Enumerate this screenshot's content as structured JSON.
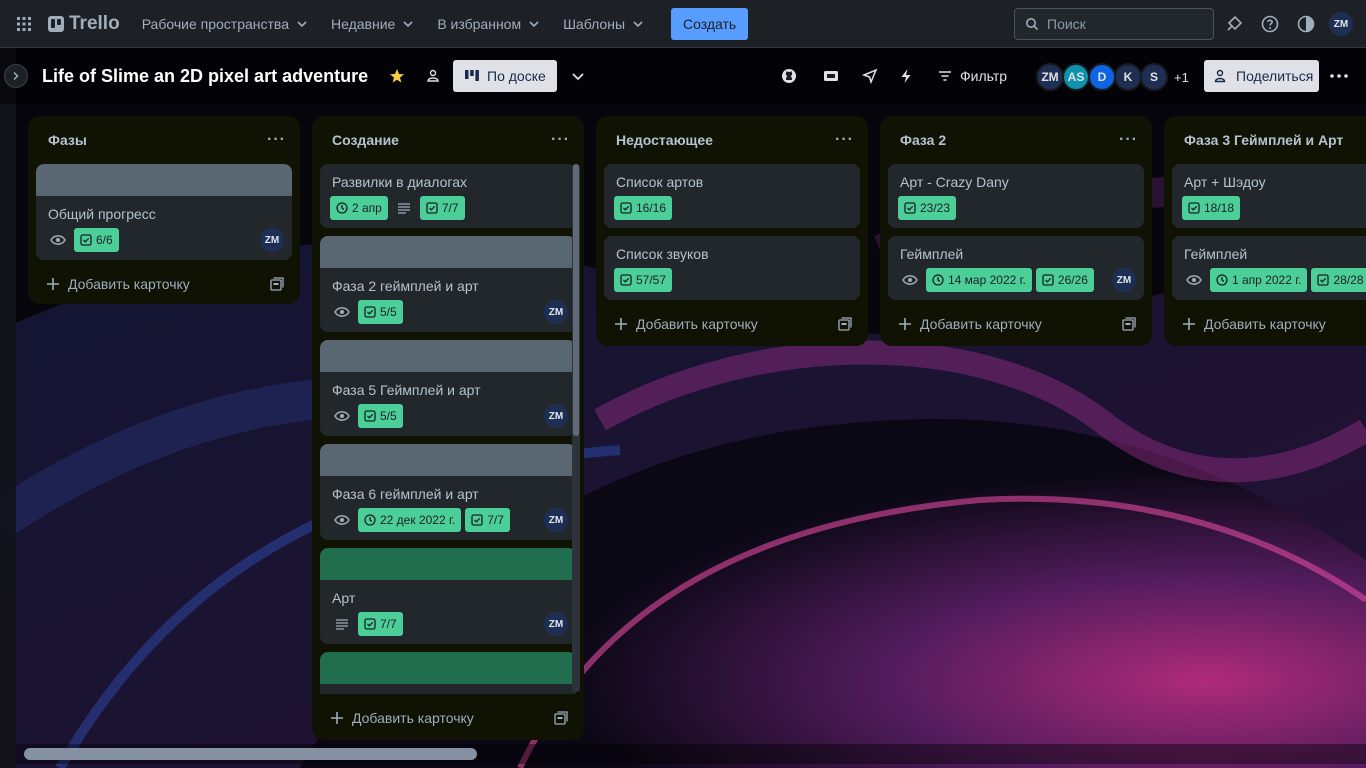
{
  "topbar": {
    "app_name": "Trello",
    "nav": [
      {
        "label": "Рабочие пространства"
      },
      {
        "label": "Недавние"
      },
      {
        "label": "В избранном"
      },
      {
        "label": "Шаблоны"
      }
    ],
    "create_label": "Создать",
    "search_placeholder": "Поиск",
    "user_initials": "ZM"
  },
  "board": {
    "title": "Life of Slime an 2D pixel art adventure",
    "view_label": "По доске",
    "filter_label": "Фильтр",
    "members": [
      {
        "initials": "ZM",
        "color": "#1f2f54"
      },
      {
        "initials": "AS",
        "color": "#0e93ad"
      },
      {
        "initials": "D",
        "color": "#0c66e4"
      },
      {
        "initials": "K",
        "color": "#1f2f54"
      },
      {
        "initials": "S",
        "color": "#1f2f54"
      }
    ],
    "members_more": "+1",
    "share_label": "Поделиться",
    "star_color": "#f5cd47"
  },
  "lists": [
    {
      "title": "Фазы",
      "add_label": "Добавить карточку",
      "cards": [
        {
          "title": "Общий прогресс",
          "cover": "#596773",
          "watch": true,
          "checklist": "6/6",
          "member": "ZM"
        }
      ]
    },
    {
      "title": "Создание",
      "add_label": "Добавить карточку",
      "cards": [
        {
          "title": "Развилки в диалогах",
          "date": "2 апр",
          "description": true,
          "checklist": "7/7"
        },
        {
          "title": "Фаза 2 геймплей и арт",
          "cover": "#596773",
          "watch": true,
          "checklist": "5/5",
          "member": "ZM"
        },
        {
          "title": "Фаза 5 Геймплей и арт",
          "cover": "#596773",
          "watch": true,
          "checklist": "5/5",
          "member": "ZM"
        },
        {
          "title": "Фаза 6 геймплей и арт",
          "cover": "#596773",
          "watch": true,
          "date": "22 дек 2022 г.",
          "checklist": "7/7",
          "member": "ZM"
        },
        {
          "title": "Арт",
          "cover": "#216e4e",
          "description": true,
          "checklist": "7/7",
          "member": "ZM"
        },
        {
          "cover": "#216e4e"
        }
      ]
    },
    {
      "title": "Недостающее",
      "add_label": "Добавить карточку",
      "cards": [
        {
          "title": "Список артов",
          "checklist": "16/16"
        },
        {
          "title": "Список звуков",
          "checklist": "57/57"
        }
      ]
    },
    {
      "title": "Фаза 2",
      "add_label": "Добавить карточку",
      "cards": [
        {
          "title": "Арт - Crazy Dany",
          "checklist": "23/23"
        },
        {
          "title": "Геймплей",
          "watch": true,
          "date": "14 мар 2022 г.",
          "checklist": "26/26",
          "member": "ZM"
        }
      ]
    },
    {
      "title": "Фаза 3 Геймплей и Арт",
      "add_label": "Добавить карточку",
      "cards": [
        {
          "title": "Арт + Шэдоу",
          "checklist": "18/18"
        },
        {
          "title": "Геймплей",
          "watch": true,
          "date": "1 апр 2022 г.",
          "checklist": "28/28"
        }
      ]
    }
  ]
}
